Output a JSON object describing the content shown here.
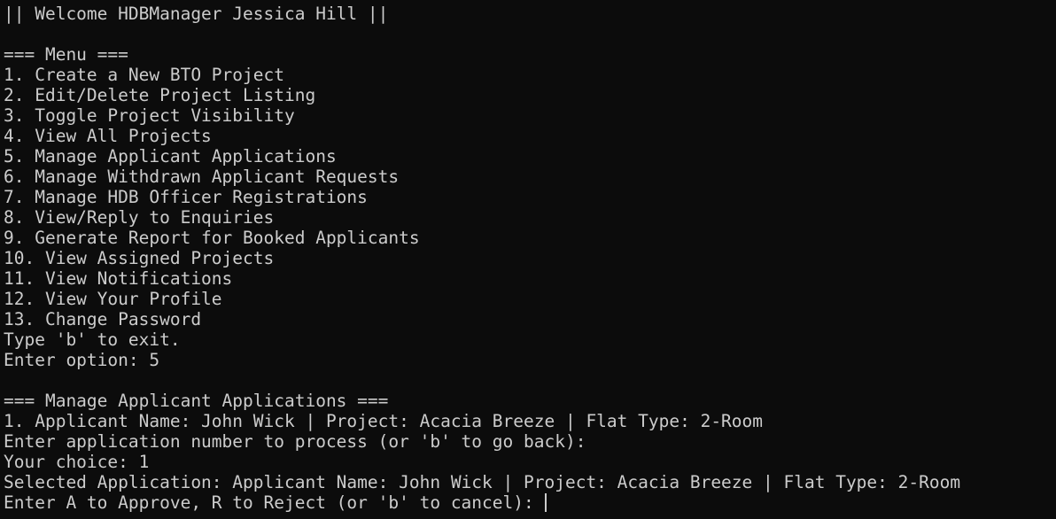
{
  "terminal": {
    "welcome": "|| Welcome HDBManager Jessica Hill ||",
    "menu_header": "=== Menu ===",
    "menu_items": [
      "1. Create a New BTO Project",
      "2. Edit/Delete Project Listing",
      "3. Toggle Project Visibility",
      "4. View All Projects",
      "5. Manage Applicant Applications",
      "6. Manage Withdrawn Applicant Requests",
      "7. Manage HDB Officer Registrations",
      "8. View/Reply to Enquiries",
      "9. Generate Report for Booked Applicants",
      "10. View Assigned Projects",
      "11. View Notifications",
      "12. View Your Profile",
      "13. Change Password"
    ],
    "exit_hint": "Type 'b' to exit.",
    "option_prompt": "Enter option: 5",
    "section_header": "=== Manage Applicant Applications ===",
    "application_line": "1. Applicant Name: John Wick | Project: Acacia Breeze | Flat Type: 2-Room",
    "process_prompt": "Enter application number to process (or 'b' to go back):",
    "choice_line": "Your choice: 1",
    "selected_line": "Selected Application: Applicant Name: John Wick | Project: Acacia Breeze | Flat Type: 2-Room",
    "action_prompt": "Enter A to Approve, R to Reject (or 'b' to cancel): "
  },
  "colors": {
    "background": "#0c0c0c",
    "foreground": "#cccccc"
  }
}
